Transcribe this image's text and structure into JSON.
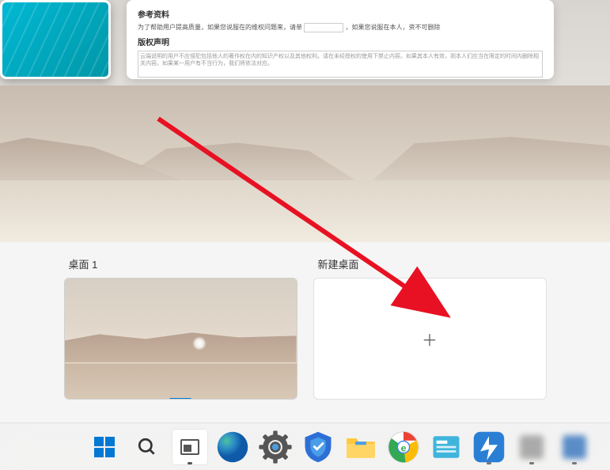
{
  "document_preview": {
    "heading1": "参考资料",
    "line1_prefix": "为了帮助用户提高质量，如果您说服在的维权问题来，请单",
    "line1_suffix": "，如果您说服在本人，资不可删除",
    "heading2": "版权声明",
    "textarea_text": "云端说明的用户不应侵犯包括他人的著作权在内的知识产权以及其他权利。请在未经授权的使用下禁止内容。如果其本人有效，则本人们应当在限定的时间内删除相关内容。如果某一用户有不当行为，我们将依法对应。"
  },
  "desktops": {
    "current_label": "桌面 1",
    "new_label": "新建桌面"
  },
  "taskbar": {
    "items": [
      "start",
      "search",
      "taskview",
      "edge",
      "settings",
      "security",
      "explorer",
      "chrome",
      "news",
      "thunder",
      "app1",
      "app2"
    ]
  },
  "annotation": {
    "arrow_color": "#e81123"
  }
}
